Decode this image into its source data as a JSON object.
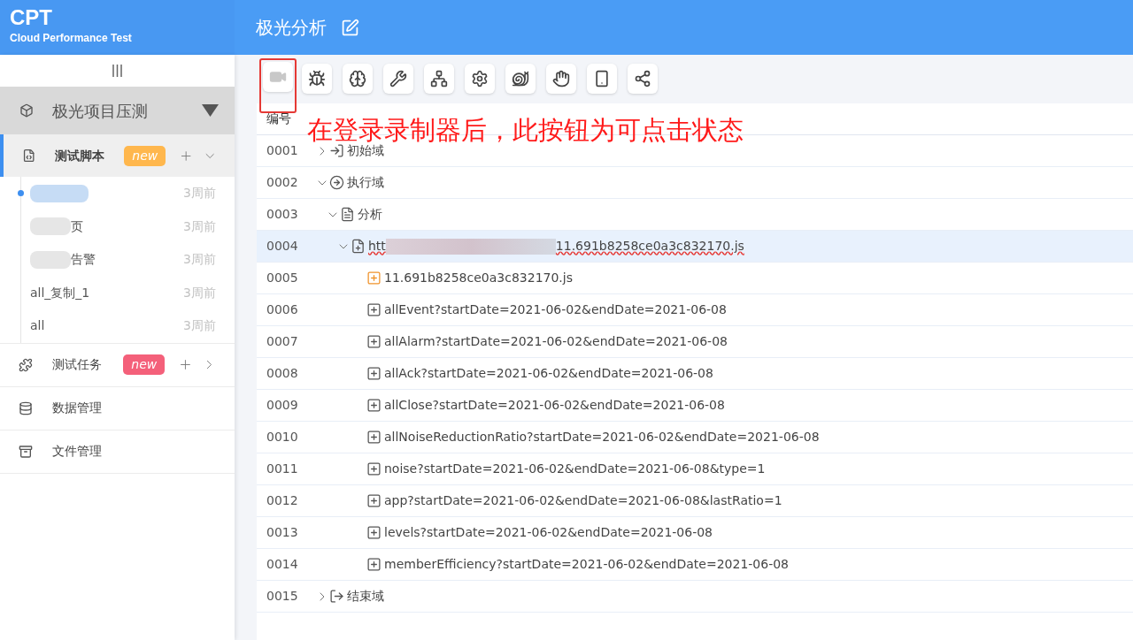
{
  "brand": {
    "title": "CPT",
    "subtitle": "Cloud Performance Test"
  },
  "page_title": "极光分析",
  "project": {
    "name": "极光项目压测",
    "expanded": true
  },
  "menu": [
    {
      "label": "测试脚本",
      "kind": "script",
      "selected": true,
      "expanded": true,
      "badge": {
        "text": "new",
        "color": "#ffb74d"
      },
      "children": [
        {
          "redacted": true,
          "time": "3周前",
          "selected": true
        },
        {
          "name": "页",
          "redacted": true,
          "time": "3周前",
          "selected": false
        },
        {
          "name": "告警",
          "redacted": true,
          "time": "3周前",
          "selected": false
        },
        {
          "name": "all_复制_1",
          "redacted": false,
          "time": "3周前",
          "selected": false
        },
        {
          "name": "all",
          "redacted": false,
          "time": "3周前",
          "selected": false
        }
      ]
    },
    {
      "label": "测试任务",
      "kind": "task",
      "selected": false,
      "expanded": false,
      "badge": {
        "text": "new",
        "color": "#f4607a"
      }
    },
    {
      "label": "数据管理",
      "kind": "data",
      "selected": false
    },
    {
      "label": "文件管理",
      "kind": "file",
      "selected": false
    }
  ],
  "toolbar": [
    {
      "kind": "video",
      "disabled": true,
      "highlighted": true
    },
    {
      "kind": "bug",
      "disabled": false,
      "highlighted": false
    },
    {
      "kind": "brain",
      "disabled": false,
      "highlighted": false
    },
    {
      "kind": "tools",
      "disabled": false,
      "highlighted": false
    },
    {
      "kind": "network",
      "disabled": false,
      "highlighted": false
    },
    {
      "kind": "gear",
      "disabled": false,
      "highlighted": false
    },
    {
      "kind": "snail",
      "disabled": false,
      "highlighted": false
    },
    {
      "kind": "hand",
      "disabled": false,
      "highlighted": false
    },
    {
      "kind": "phone",
      "disabled": false,
      "highlighted": false
    },
    {
      "kind": "share",
      "disabled": false,
      "highlighted": false
    }
  ],
  "annotation": "在登录录制器后，此按钮为可点击状态",
  "table": {
    "columns": [
      "编号"
    ],
    "rows": [
      {
        "no": "0001",
        "kind": "enter",
        "name": "初始域",
        "expanded": false,
        "selected": false
      },
      {
        "no": "0002",
        "kind": "run",
        "name": "执行域",
        "expanded": true,
        "selected": false,
        "children": [
          {
            "no": "0003",
            "kind": "group",
            "name": "分析",
            "expanded": true,
            "selected": false,
            "children": [
              {
                "no": "0004",
                "kind": "page",
                "name": "htt",
                "name_end": "11.691b8258ce0a3c832170.js",
                "redacted": true,
                "expanded": true,
                "selected": true,
                "children": [
                  {
                    "no": "0005",
                    "kind": "file",
                    "name": "11.691b8258ce0a3c832170.js",
                    "selected": false
                  },
                  {
                    "no": "0006",
                    "kind": "api",
                    "name": "allEvent?startDate=2021-06-02&endDate=2021-06-08",
                    "selected": false
                  },
                  {
                    "no": "0007",
                    "kind": "api",
                    "name": "allAlarm?startDate=2021-06-02&endDate=2021-06-08",
                    "selected": false
                  },
                  {
                    "no": "0008",
                    "kind": "api",
                    "name": "allAck?startDate=2021-06-02&endDate=2021-06-08",
                    "selected": false
                  },
                  {
                    "no": "0009",
                    "kind": "api",
                    "name": "allClose?startDate=2021-06-02&endDate=2021-06-08",
                    "selected": false
                  },
                  {
                    "no": "0010",
                    "kind": "api",
                    "name": "allNoiseReductionRatio?startDate=2021-06-02&endDate=2021-06-08",
                    "selected": false
                  },
                  {
                    "no": "0011",
                    "kind": "api",
                    "name": "noise?startDate=2021-06-02&endDate=2021-06-08&type=1",
                    "selected": false
                  },
                  {
                    "no": "0012",
                    "kind": "api",
                    "name": "app?startDate=2021-06-02&endDate=2021-06-08&lastRatio=1",
                    "selected": false
                  },
                  {
                    "no": "0013",
                    "kind": "api",
                    "name": "levels?startDate=2021-06-02&endDate=2021-06-08",
                    "selected": false
                  },
                  {
                    "no": "0014",
                    "kind": "api",
                    "name": "memberEfficiency?startDate=2021-06-02&endDate=2021-06-08",
                    "selected": false
                  }
                ]
              }
            ]
          }
        ]
      },
      {
        "no": "0015",
        "kind": "exit",
        "name": "结束域",
        "expanded": false,
        "selected": false
      }
    ]
  }
}
